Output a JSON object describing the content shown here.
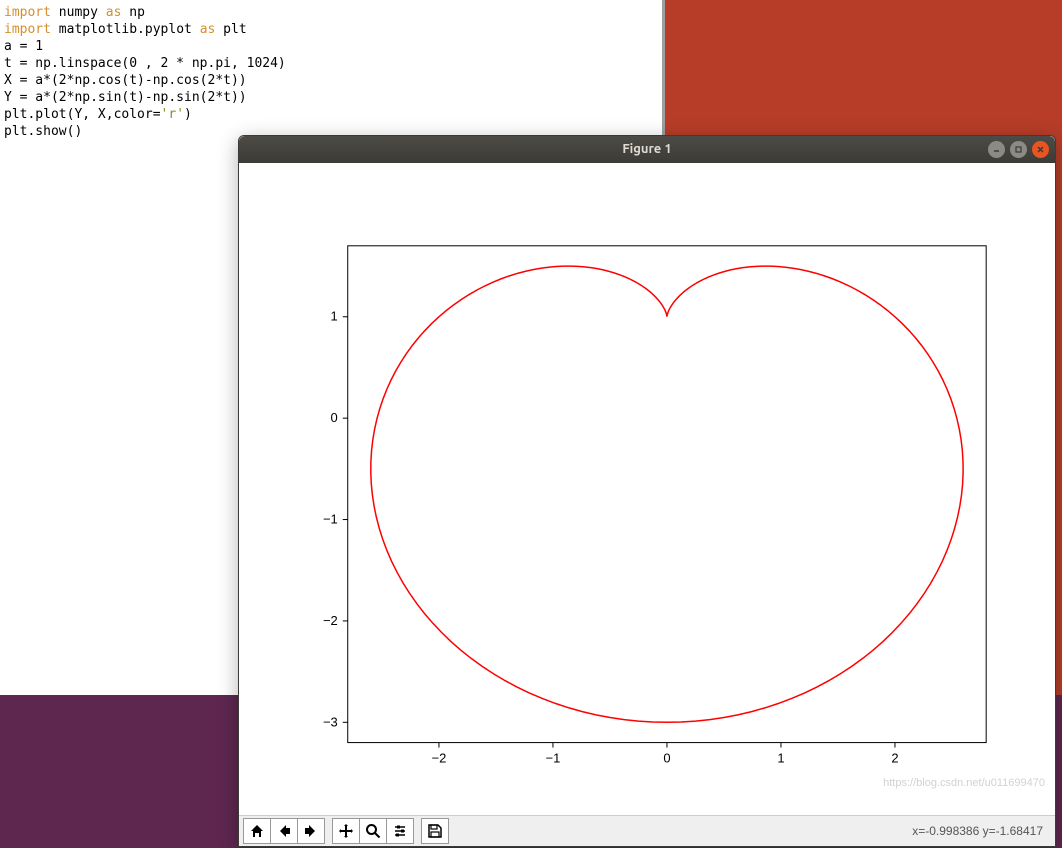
{
  "code": {
    "line1_import": "import",
    "line1_mod": " numpy ",
    "line1_as": "as",
    "line1_alias": " np",
    "line2_import": "import",
    "line2_mod": " matplotlib.pyplot ",
    "line2_as": "as",
    "line2_alias": " plt",
    "line3": "a = 1",
    "line4": "t = np.linspace(0 , 2 * np.pi, 1024)",
    "line5": "X = a*(2*np.cos(t)-np.cos(2*t))",
    "line6": "Y = a*(2*np.sin(t)-np.sin(2*t))",
    "line7a": "plt.plot(Y, X,color=",
    "line7b": "'r'",
    "line7c": ")",
    "line8": "plt.show()"
  },
  "figure": {
    "title": "Figure 1",
    "coords": "x=-0.998386   y=-1.68417",
    "watermark": "https://blog.csdn.net/u011699470"
  },
  "chart_data": {
    "type": "line",
    "title": "",
    "xlabel": "",
    "ylabel": "",
    "xlim": [
      -2.8,
      2.8
    ],
    "ylim": [
      -3.2,
      1.7
    ],
    "xticks": [
      -2,
      -1,
      0,
      1,
      2
    ],
    "yticks": [
      -3,
      -2,
      -1,
      0,
      1
    ],
    "color": "r",
    "parametric": {
      "description": "Cardioid: X=a(2cos t - cos 2t), Y=a(2sin t - sin 2t), a=1, plotted as (Y,X)",
      "a": 1,
      "t_range": [
        0,
        6.283185307179586
      ],
      "n_points": 1024,
      "sample_points_plotY_plotX": [
        [
          0.0,
          1.0
        ],
        [
          0.5,
          1.48
        ],
        [
          1.598,
          1.366
        ],
        [
          2.45,
          0.732
        ],
        [
          2.598,
          0.5
        ],
        [
          2.699,
          0.0
        ],
        [
          2.45,
          -0.732
        ],
        [
          1.732,
          -2.0
        ],
        [
          0.772,
          -2.848
        ],
        [
          0.0,
          -3.0
        ],
        [
          -0.772,
          -2.848
        ],
        [
          -1.732,
          -2.0
        ],
        [
          -2.45,
          -0.732
        ],
        [
          -2.699,
          0.0
        ],
        [
          -2.598,
          0.5
        ],
        [
          -2.45,
          0.732
        ],
        [
          -1.598,
          1.366
        ],
        [
          -0.5,
          1.48
        ],
        [
          0.0,
          1.0
        ]
      ]
    }
  },
  "toolbar": {
    "home": "home-icon",
    "back": "back-icon",
    "forward": "forward-icon",
    "pan": "pan-icon",
    "zoom": "zoom-icon",
    "configure": "configure-icon",
    "save": "save-icon"
  }
}
